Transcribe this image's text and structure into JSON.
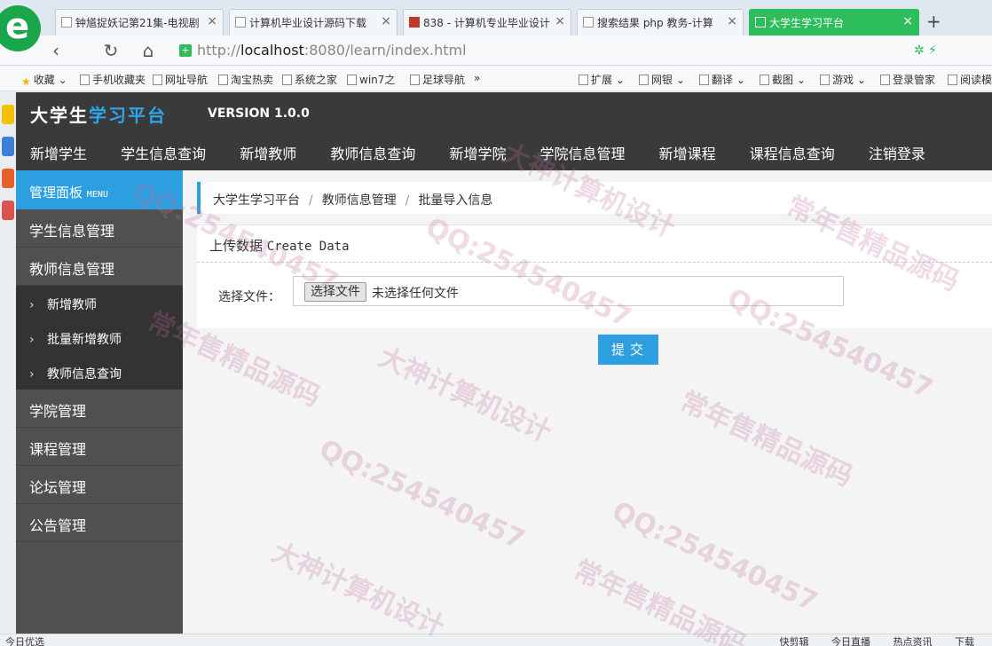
{
  "browser": {
    "tabs": [
      {
        "label": "钟馗捉妖记第21集-电视剧"
      },
      {
        "label": "计算机毕业设计源码下载"
      },
      {
        "label": "838 - 计算机专业毕业设计"
      },
      {
        "label": "搜索结果 php 教务-计算"
      },
      {
        "label": "大学生学习平台"
      }
    ],
    "url_prefix": "http://",
    "url_host": "localhost",
    "url_rest": ":8080/learn/index.html",
    "bookmarks": [
      "收藏",
      "手机收藏夹",
      "网址导航",
      "淘宝热卖",
      "系统之家",
      "win7之",
      "足球导航",
      "»"
    ],
    "tools": [
      "扩展",
      "网银",
      "翻译",
      "截图",
      "游戏",
      "登录管家",
      "阅读模"
    ],
    "status_left": "今日优选",
    "status_right": [
      "快剪辑",
      "今日直播",
      "热点资讯",
      "下载"
    ]
  },
  "app": {
    "brand_plain": "大学生",
    "brand_accent": "学习平台",
    "version": "VERSION 1.0.0",
    "topnav": [
      "新增学生",
      "学生信息查询",
      "新增教师",
      "教师信息查询",
      "新增学院",
      "学院信息管理",
      "新增课程",
      "课程信息查询",
      "注销登录"
    ]
  },
  "sidebar": {
    "panel_title": "管理面板",
    "panel_title_en": "MENU",
    "items": [
      "学生信息管理",
      "教师信息管理"
    ],
    "sub_items": [
      "新增教师",
      "批量新增教师",
      "教师信息查询"
    ],
    "items_after": [
      "学院管理",
      "课程管理",
      "论坛管理",
      "公告管理"
    ]
  },
  "main": {
    "breadcrumb": [
      "大学生学习平台",
      "教师信息管理",
      "批量导入信息"
    ],
    "card_title": "上传数据",
    "card_title_en": "Create Data",
    "field_label": "选择文件：",
    "file_button": "选择文件",
    "file_status": "未选择任何文件",
    "submit_label": "提交"
  },
  "watermark": {
    "texts": [
      "QQ:254540457",
      "大神计算机设计",
      "常年售精品源码"
    ]
  },
  "colors": {
    "accent": "#2d9fe0",
    "header_bg": "#3b3a3b",
    "sidebar_bg": "#505050",
    "browser_active_tab": "#2ebd5b"
  }
}
